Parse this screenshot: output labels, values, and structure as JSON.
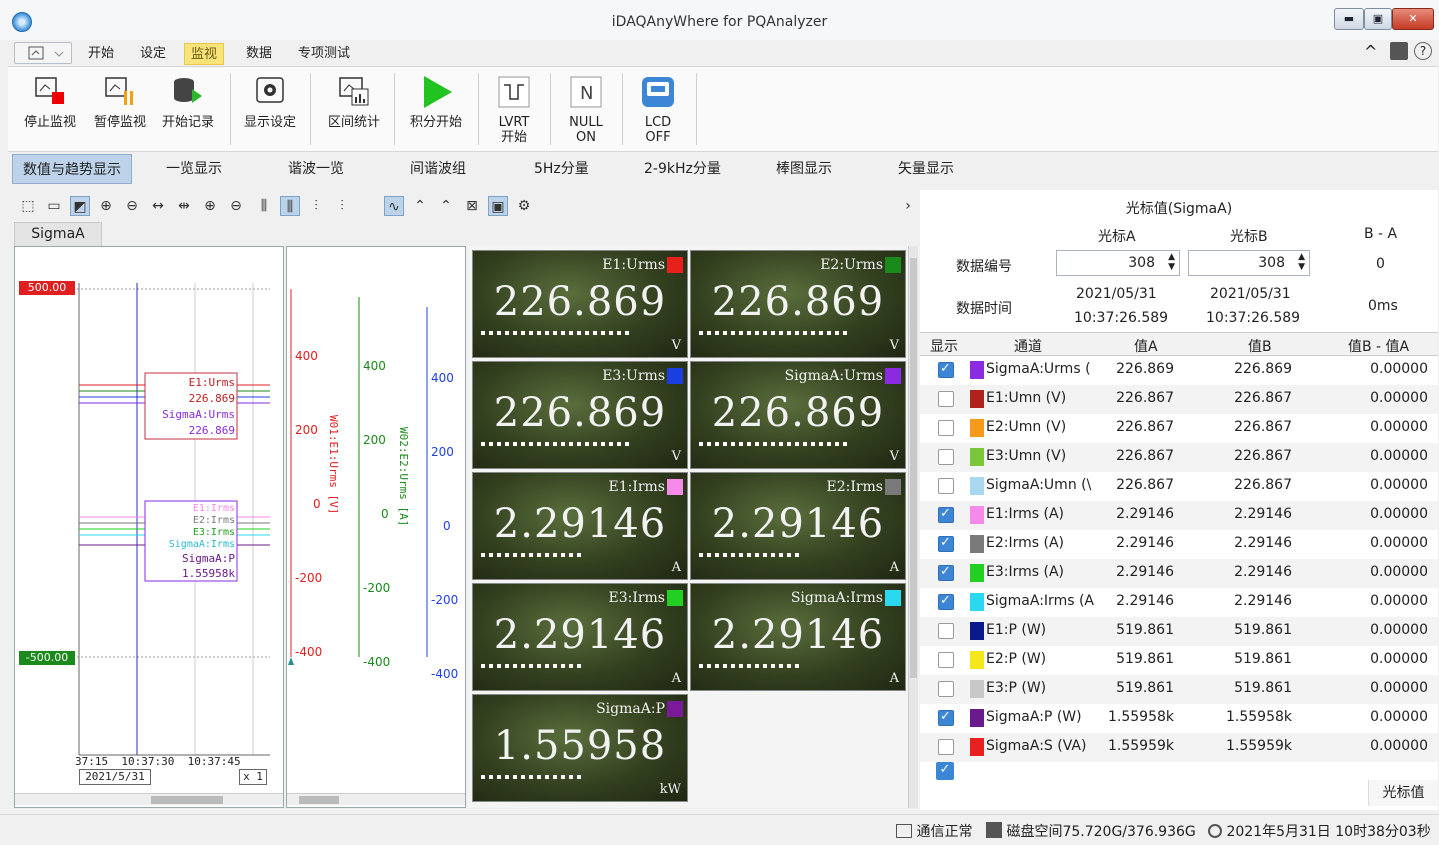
{
  "window": {
    "title": "iDAQAnyWhere for PQAnalyzer",
    "min": "▬",
    "max": "▣",
    "close": "✕"
  },
  "menu": {
    "items": [
      "开始",
      "设定",
      "监视",
      "数据",
      "专项测试"
    ],
    "active_index": 2
  },
  "ribbon": {
    "buttons": [
      "停止监视",
      "暂停监视",
      "开始记录",
      "显示设定",
      "区间统计",
      "积分开始",
      "LVRT\n开始",
      "NULL\nON",
      "LCD\nOFF"
    ]
  },
  "tabs": [
    "数值与趋势显示",
    "一览显示",
    "谐波一览",
    "间谐波组",
    "5Hz分量",
    "2-9kHz分量",
    "棒图显示",
    "矢量显示"
  ],
  "left": {
    "sigma_tab": "SigmaA",
    "trend": {
      "top_value": "500.00",
      "bottom_value": "-500.00",
      "box1": [
        "E1:Urms",
        "226.869",
        "SigmaA:Urms",
        "226.869"
      ],
      "box2": [
        "E1:Irms",
        "E2:Irms",
        "E3:Irms",
        "SigmaA:Irms",
        "SigmaA:P",
        "1.55958k"
      ],
      "time_labels": "37:15  10:37:30  10:37:45",
      "date": "2021/5/31",
      "zoom": "x 1"
    },
    "axes": {
      "red_ticks": [
        "400",
        "200",
        "0",
        "-200",
        "-400"
      ],
      "green_ticks": [
        "400",
        "200",
        "0",
        "-200",
        "-400"
      ],
      "blue_ticks": [
        "400",
        "200",
        "0",
        "-200",
        "-400"
      ],
      "red_title": "W01:E1:Urms [V]",
      "green_title": "W02:E2:Urms [A]"
    }
  },
  "meters": [
    {
      "label": "E1:Urms",
      "value": "226.869",
      "unit": "V",
      "color": "#e8201c"
    },
    {
      "label": "E2:Urms",
      "value": "226.869",
      "unit": "V",
      "color": "#1a8a1a"
    },
    {
      "label": "E3:Urms",
      "value": "226.869",
      "unit": "V",
      "color": "#1a3ee0"
    },
    {
      "label": "SigmaA:Urms",
      "value": "226.869",
      "unit": "V",
      "color": "#8a2be2"
    },
    {
      "label": "E1:Irms",
      "value": "2.29146",
      "unit": "A",
      "color": "#f58ae8"
    },
    {
      "label": "E2:Irms",
      "value": "2.29146",
      "unit": "A",
      "color": "#7a7a7a"
    },
    {
      "label": "E3:Irms",
      "value": "2.29146",
      "unit": "A",
      "color": "#22d022"
    },
    {
      "label": "SigmaA:Irms",
      "value": "2.29146",
      "unit": "A",
      "color": "#2ad8f0"
    },
    {
      "label": "SigmaA:P",
      "value": "1.55958",
      "unit": "kW",
      "color": "#7a1a9a"
    }
  ],
  "cursor": {
    "title": "光标值(SigmaA)",
    "col_a": "光标A",
    "col_b": "光标B",
    "col_ba": "B - A",
    "data_no_label": "数据编号",
    "data_no_a": "308",
    "data_no_b": "308",
    "data_no_diff": "0",
    "time_label": "数据时间",
    "time_a": [
      "2021/05/31",
      "10:37:26.589"
    ],
    "time_b": [
      "2021/05/31",
      "10:37:26.589"
    ],
    "time_diff": "0ms",
    "headers": [
      "显示",
      "通道",
      "值A",
      "值B",
      "值B - 值A"
    ],
    "rows": [
      {
        "checked": true,
        "color": "#8a2be2",
        "name": "SigmaA:Urms (",
        "a": "226.869",
        "b": "226.869",
        "d": "0.00000"
      },
      {
        "checked": false,
        "color": "#b0221c",
        "name": "E1:Umn (V)",
        "a": "226.867",
        "b": "226.867",
        "d": "0.00000"
      },
      {
        "checked": false,
        "color": "#f59a1a",
        "name": "E2:Umn (V)",
        "a": "226.867",
        "b": "226.867",
        "d": "0.00000"
      },
      {
        "checked": false,
        "color": "#7ac83a",
        "name": "E3:Umn (V)",
        "a": "226.867",
        "b": "226.867",
        "d": "0.00000"
      },
      {
        "checked": false,
        "color": "#a8d8ef",
        "name": "SigmaA:Umn (\\",
        "a": "226.867",
        "b": "226.867",
        "d": "0.00000"
      },
      {
        "checked": true,
        "color": "#f58ae8",
        "name": "E1:Irms (A)",
        "a": "2.29146",
        "b": "2.29146",
        "d": "0.00000"
      },
      {
        "checked": true,
        "color": "#7a7a7a",
        "name": "E2:Irms (A)",
        "a": "2.29146",
        "b": "2.29146",
        "d": "0.00000"
      },
      {
        "checked": true,
        "color": "#22d022",
        "name": "E3:Irms (A)",
        "a": "2.29146",
        "b": "2.29146",
        "d": "0.00000"
      },
      {
        "checked": true,
        "color": "#2ad8f0",
        "name": "SigmaA:Irms (A",
        "a": "2.29146",
        "b": "2.29146",
        "d": "0.00000"
      },
      {
        "checked": false,
        "color": "#0a1a8a",
        "name": "E1:P (W)",
        "a": "519.861",
        "b": "519.861",
        "d": "0.00000"
      },
      {
        "checked": false,
        "color": "#f5e81a",
        "name": "E2:P (W)",
        "a": "519.861",
        "b": "519.861",
        "d": "0.00000"
      },
      {
        "checked": false,
        "color": "#c8c8c8",
        "name": "E3:P (W)",
        "a": "519.861",
        "b": "519.861",
        "d": "0.00000"
      },
      {
        "checked": true,
        "color": "#6a1a8a",
        "name": "SigmaA:P (W)",
        "a": "1.55958k",
        "b": "1.55958k",
        "d": "0.00000"
      },
      {
        "checked": false,
        "color": "#e82020",
        "name": "SigmaA:S (VA)",
        "a": "1.55959k",
        "b": "1.55959k",
        "d": "0.00000"
      }
    ],
    "footer_button": "光标值"
  },
  "status": {
    "comm": "通信正常",
    "disk": "磁盘空间75.720G/376.936G",
    "clock": "2021年5月31日 10时38分03秒"
  }
}
